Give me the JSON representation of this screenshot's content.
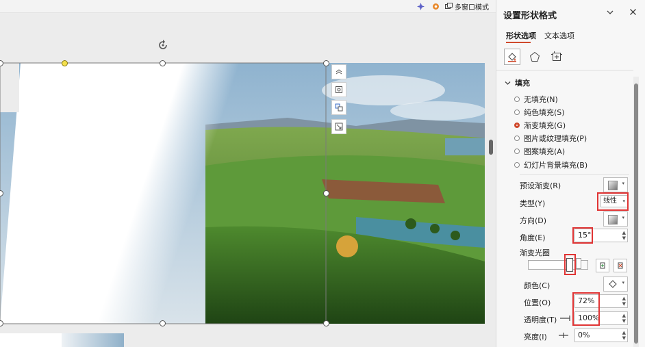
{
  "topbar": {
    "multiwindow_label": "多窗口模式"
  },
  "panel": {
    "title": "设置形状格式",
    "tabs": [
      "形状选项",
      "文本选项"
    ],
    "section_fill": "填充",
    "fill_options": [
      {
        "label": "无填充(N)",
        "selected": false
      },
      {
        "label": "纯色填充(S)",
        "selected": false
      },
      {
        "label": "渐变填充(G)",
        "selected": true
      },
      {
        "label": "图片或纹理填充(P)",
        "selected": false
      },
      {
        "label": "图案填充(A)",
        "selected": false
      },
      {
        "label": "幻灯片背景填充(B)",
        "selected": false
      }
    ],
    "preset_gradient_label": "预设渐变(R)",
    "type_label": "类型(Y)",
    "type_value": "线性",
    "direction_label": "方向(D)",
    "angle_label": "角度(E)",
    "angle_value": "15°",
    "gradient_stops_label": "渐变光圈",
    "color_label": "颜色(C)",
    "position_label": "位置(O)",
    "position_value": "72%",
    "transparency_label": "透明度(T)",
    "transparency_value": "100%",
    "brightness_label": "亮度(I)",
    "brightness_value": "0%"
  },
  "colors": {
    "accent": "#d04a2c",
    "highlight": "#e03434"
  }
}
